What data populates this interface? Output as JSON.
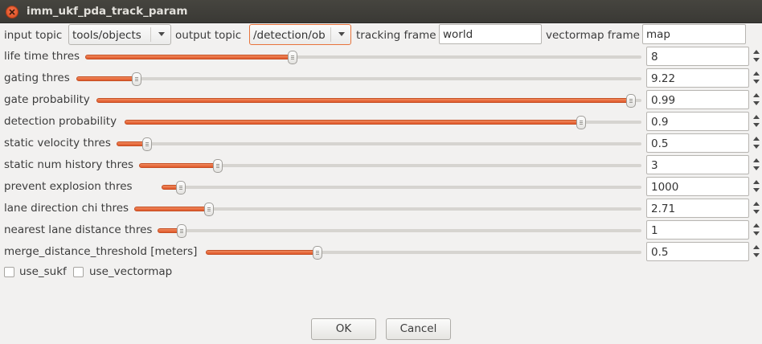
{
  "window": {
    "title": "imm_ukf_pda_track_param"
  },
  "topics": {
    "input_topic_label": "input topic",
    "input_topic_value": "tools/objects",
    "output_topic_label": "output topic",
    "output_topic_value": "/detection/ob",
    "tracking_frame_label": "tracking frame",
    "tracking_frame_value": "world",
    "vectormap_frame_label": "vectormap frame",
    "vectormap_frame_value": "map"
  },
  "sliders": [
    {
      "label": "life time thres",
      "value": "8",
      "level": 0.37
    },
    {
      "label": "gating thres",
      "value": "9.22",
      "level": 0.1
    },
    {
      "label": "gate probability",
      "value": "0.99",
      "level": 0.99
    },
    {
      "label": "detection probability",
      "value": "0.9",
      "level": 0.89
    },
    {
      "label": "static velocity thres",
      "value": "0.5",
      "level": 0.05
    },
    {
      "label": "static num history thres",
      "value": "3",
      "level": 0.15
    },
    {
      "label": "prevent explosion thres",
      "value": "1000",
      "level": 0.03
    },
    {
      "label": "lane direction chi thres",
      "value": "2.71",
      "level": 0.14
    },
    {
      "label": "nearest lane distance thres",
      "value": "1",
      "level": 0.04
    },
    {
      "label": "merge_distance_threshold [meters]",
      "value": "0.5",
      "level": 0.25
    }
  ],
  "options": {
    "use_sukf_label": "use_sukf",
    "use_sukf_checked": false,
    "use_vectormap_label": "use_vectormap",
    "use_vectormap_checked": false
  },
  "buttons": {
    "ok": "OK",
    "cancel": "Cancel"
  },
  "colors": {
    "accent": "#e0582a",
    "titlebar": "#3c3b37",
    "background": "#f2f1f0"
  }
}
